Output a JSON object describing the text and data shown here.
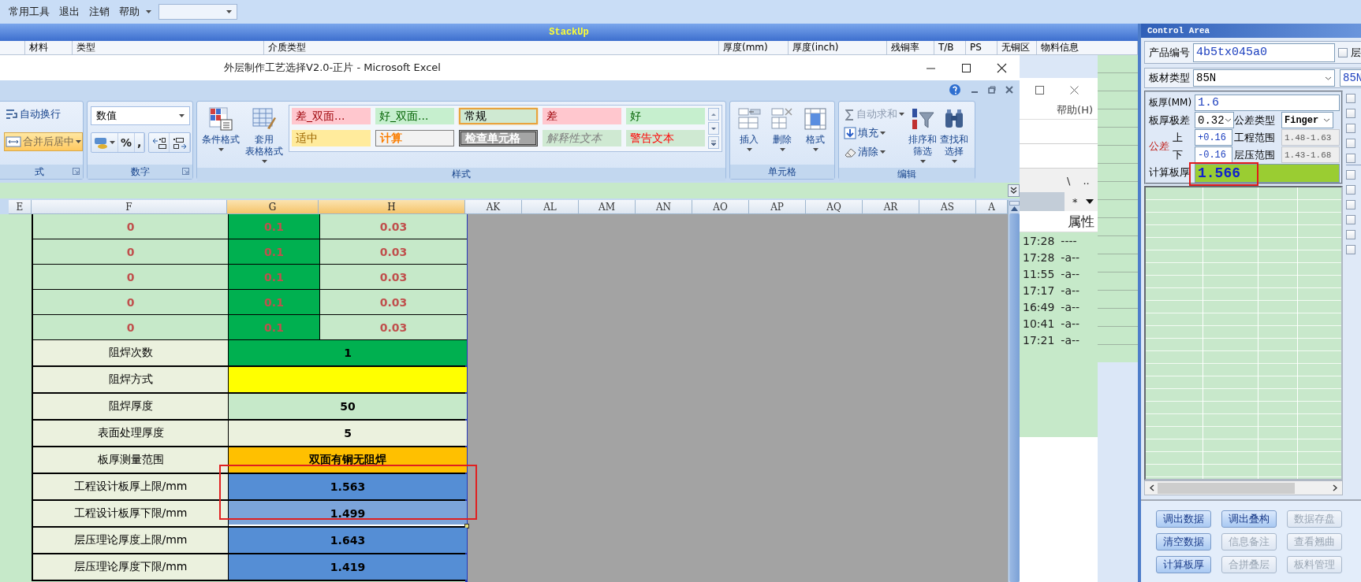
{
  "menu_bar": {
    "items": [
      {
        "label": "常用工具",
        "dropdown": false
      },
      {
        "label": "退出",
        "dropdown": false
      },
      {
        "label": "注销",
        "dropdown": false
      },
      {
        "label": "帮助",
        "dropdown": true
      }
    ]
  },
  "stackup": {
    "title": "StackUp",
    "columns": [
      "材料",
      "类型",
      "介质类型",
      "厚度(mm)",
      "厚度(inch)",
      "残铜率",
      "T/B",
      "PS",
      "无铜区",
      "物料信息"
    ]
  },
  "excel": {
    "title": "外层制作工艺选择V2.0-正片 - Microsoft Excel",
    "ribbon": {
      "alignment": {
        "label": "式",
        "launcher": true,
        "buttons": [
          {
            "label": "自动换行",
            "highlighted": false,
            "dropdown": false
          },
          {
            "label": "合并后居中",
            "highlighted": true,
            "dropdown": true
          }
        ]
      },
      "number": {
        "label": "数字",
        "launcher": true,
        "format": "数值",
        "symbols": [
          "%",
          ","
        ]
      },
      "styles": {
        "label": "样式",
        "launcher": false,
        "commands": [
          {
            "lines": [
              "条件格式"
            ],
            "dropdown": true
          },
          {
            "lines": [
              "套用",
              "表格格式"
            ],
            "dropdown": true
          }
        ],
        "gallery": [
          {
            "label": "差_双面...",
            "kind": "bad",
            "selected": false
          },
          {
            "label": "好_双面...",
            "kind": "good",
            "selected": false
          },
          {
            "label": "常规",
            "kind": "normal",
            "selected": true
          },
          {
            "label": "差",
            "kind": "bad",
            "selected": false
          },
          {
            "label": "好",
            "kind": "good",
            "selected": false
          },
          {
            "label": "适中",
            "kind": "neutral",
            "selected": false
          },
          {
            "label": "计算",
            "kind": "calculation",
            "selected": false
          },
          {
            "label": "检查单元格",
            "kind": "check",
            "selected": false
          },
          {
            "label": "解释性文本",
            "kind": "explanatory",
            "selected": false
          },
          {
            "label": "警告文本",
            "kind": "warning",
            "selected": false
          }
        ]
      },
      "cells": {
        "label": "单元格",
        "launcher": false,
        "commands": [
          {
            "lines": [
              "插入"
            ],
            "dropdown": true
          },
          {
            "lines": [
              "删除"
            ],
            "dropdown": true
          },
          {
            "lines": [
              "格式"
            ],
            "dropdown": true
          }
        ]
      },
      "editing": {
        "label": "编辑",
        "launcher": false,
        "small": [
          {
            "label": "自动求和",
            "disabled": true,
            "dropdown": true
          },
          {
            "label": "填充",
            "disabled": false,
            "dropdown": true
          },
          {
            "label": "清除",
            "disabled": false,
            "dropdown": true
          }
        ],
        "commands": [
          {
            "lines": [
              "排序和",
              "筛选"
            ],
            "dropdown": true
          },
          {
            "lines": [
              "查找和",
              "选择"
            ],
            "dropdown": true
          }
        ]
      }
    },
    "sheet": {
      "columns": [
        {
          "label": "E",
          "selected": false
        },
        {
          "label": "F",
          "selected": false
        },
        {
          "label": "G",
          "selected": true
        },
        {
          "label": "H",
          "selected": true
        },
        {
          "label": "AK",
          "selected": false
        },
        {
          "label": "AL",
          "selected": false
        },
        {
          "label": "AM",
          "selected": false
        },
        {
          "label": "AN",
          "selected": false
        },
        {
          "label": "AO",
          "selected": false
        },
        {
          "label": "AP",
          "selected": false
        },
        {
          "label": "AQ",
          "selected": false
        },
        {
          "label": "AR",
          "selected": false
        },
        {
          "label": "AS",
          "selected": false
        },
        {
          "label": "A",
          "selected": false
        }
      ],
      "rows": [
        {
          "kind": "values",
          "cells": [
            "0",
            "0.1",
            "0.03"
          ],
          "selected": false,
          "highlighted": false
        },
        {
          "kind": "values",
          "cells": [
            "0",
            "0.1",
            "0.03"
          ],
          "selected": false,
          "highlighted": false
        },
        {
          "kind": "values",
          "cells": [
            "0",
            "0.1",
            "0.03"
          ],
          "selected": false,
          "highlighted": false
        },
        {
          "kind": "values",
          "cells": [
            "0",
            "0.1",
            "0.03"
          ],
          "selected": false,
          "highlighted": false
        },
        {
          "kind": "values",
          "cells": [
            "0",
            "0.1",
            "0.03"
          ],
          "selected": false,
          "highlighted": false
        },
        {
          "kind": "field",
          "label": "阻焊次数",
          "value": "1",
          "color": "#00b050",
          "selected": false,
          "highlighted": false
        },
        {
          "kind": "field",
          "label": "阻焊方式",
          "color": "#ffff00",
          "selected": false,
          "highlighted": false
        },
        {
          "kind": "field",
          "label": "阻焊厚度",
          "value": "50",
          "color": "#c6e9c9",
          "selected": false,
          "highlighted": false
        },
        {
          "kind": "field",
          "label": "表面处理厚度",
          "value": "5",
          "color": "#ebf1de",
          "selected": false,
          "highlighted": false
        },
        {
          "kind": "field",
          "label": "板厚测量范围",
          "value": "双面有铜无阻焊",
          "color": "#ffc000",
          "selected": false,
          "highlighted": false
        },
        {
          "kind": "field",
          "label": "工程设计板厚上限/mm",
          "value": "1.563",
          "color": "#558ed5",
          "selected": false,
          "highlighted": true
        },
        {
          "kind": "field",
          "label": "工程设计板厚下限/mm",
          "value": "1.499",
          "color": "#7ba4da",
          "selected": true,
          "highlighted": true
        },
        {
          "kind": "field",
          "label": "层压理论厚度上限/mm",
          "value": "1.643",
          "color": "#558ed5",
          "selected": false,
          "highlighted": false
        },
        {
          "kind": "field",
          "label": "层压理论厚度下限/mm",
          "value": "1.419",
          "color": "#558ed5",
          "selected": false,
          "highlighted": false
        }
      ]
    }
  },
  "explorer": {
    "menu": "帮助(H)",
    "toolbar": [
      "\\",
      "..",
      "*"
    ],
    "columns": [
      "属性"
    ],
    "rows": [
      {
        "time": "17:28",
        "attributes": "----"
      },
      {
        "time": "17:28",
        "attributes": "-a--"
      },
      {
        "time": "11:55",
        "attributes": "-a--"
      },
      {
        "time": "17:17",
        "attributes": "-a--"
      },
      {
        "time": "16:49",
        "attributes": "-a--"
      },
      {
        "time": "10:41",
        "attributes": "-a--"
      },
      {
        "time": "17:21",
        "attributes": "-a--"
      }
    ]
  },
  "control_area": {
    "title": "Control Area",
    "product_no": {
      "label": "产品编号",
      "value": "4b5tx045a0"
    },
    "layer_option": {
      "label": "层",
      "checked": false
    },
    "board_type": {
      "label": "板材类型",
      "value": "85N",
      "second_value": "85N"
    },
    "thickness": {
      "label": "板厚(MM)",
      "value": "1.6"
    },
    "tolerance_range": {
      "label": "板厚极差",
      "value": "0.32"
    },
    "tolerance_type": {
      "label": "公差类型",
      "value": "Finger"
    },
    "tolerance": {
      "label": "公差",
      "upper_label": "上",
      "upper": "+0.16",
      "lower_label": "下",
      "lower": "-0.16"
    },
    "engineering_range": {
      "label": "工程范围",
      "value": "1.48-1.63",
      "disabled": true
    },
    "lamination_range": {
      "label": "层压范围",
      "value": "1.43-1.68",
      "disabled": true
    },
    "calculated": {
      "label": "计算板厚",
      "value": "1.566",
      "highlighted": true
    },
    "options": [
      {
        "checked": false
      },
      {
        "checked": false
      },
      {
        "checked": false
      },
      {
        "checked": false
      },
      {
        "checked": false
      },
      {
        "checked": false
      },
      {
        "checked": false
      },
      {
        "checked": false
      },
      {
        "checked": false
      },
      {
        "checked": false
      },
      {
        "checked": false
      }
    ],
    "buttons": [
      {
        "label": "调出数据",
        "disabled": false
      },
      {
        "label": "调出叠构",
        "disabled": false
      },
      {
        "label": "数据存盘",
        "disabled": true
      },
      {
        "label": "清空数据",
        "disabled": false
      },
      {
        "label": "信息备注",
        "disabled": true
      },
      {
        "label": "查看翘曲",
        "disabled": true
      },
      {
        "label": "计算板厚",
        "disabled": false
      },
      {
        "label": "合拼叠层",
        "disabled": true
      },
      {
        "label": "板料管理",
        "disabled": true
      }
    ]
  }
}
